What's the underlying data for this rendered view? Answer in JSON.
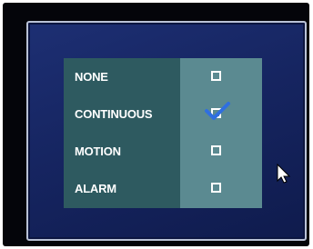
{
  "record_mode": {
    "options": [
      {
        "label": "NONE",
        "checked": false
      },
      {
        "label": "CONTINUOUS",
        "checked": true
      },
      {
        "label": "MOTION",
        "checked": false
      },
      {
        "label": "ALARM",
        "checked": false
      }
    ]
  },
  "colors": {
    "dialog_bg": "#1b2c6c",
    "label_column": "#2e5a60",
    "checkbox_column": "#5b8a91",
    "check_mark": "#2f6fe0",
    "text": "#ffffff"
  },
  "icons": {
    "check": "check-icon",
    "cursor": "mouse-pointer-icon"
  }
}
